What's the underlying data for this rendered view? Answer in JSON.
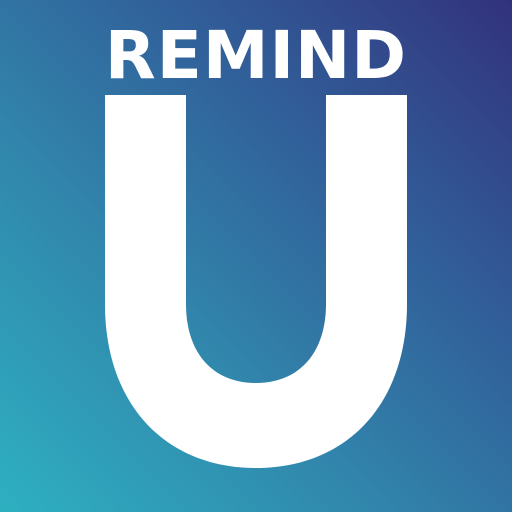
{
  "icon": {
    "wordmark": "REMIND",
    "letter": "U",
    "colors": {
      "gradient_start": "#2eb0c1",
      "gradient_end": "#32327c",
      "text": "#ffffff"
    }
  }
}
